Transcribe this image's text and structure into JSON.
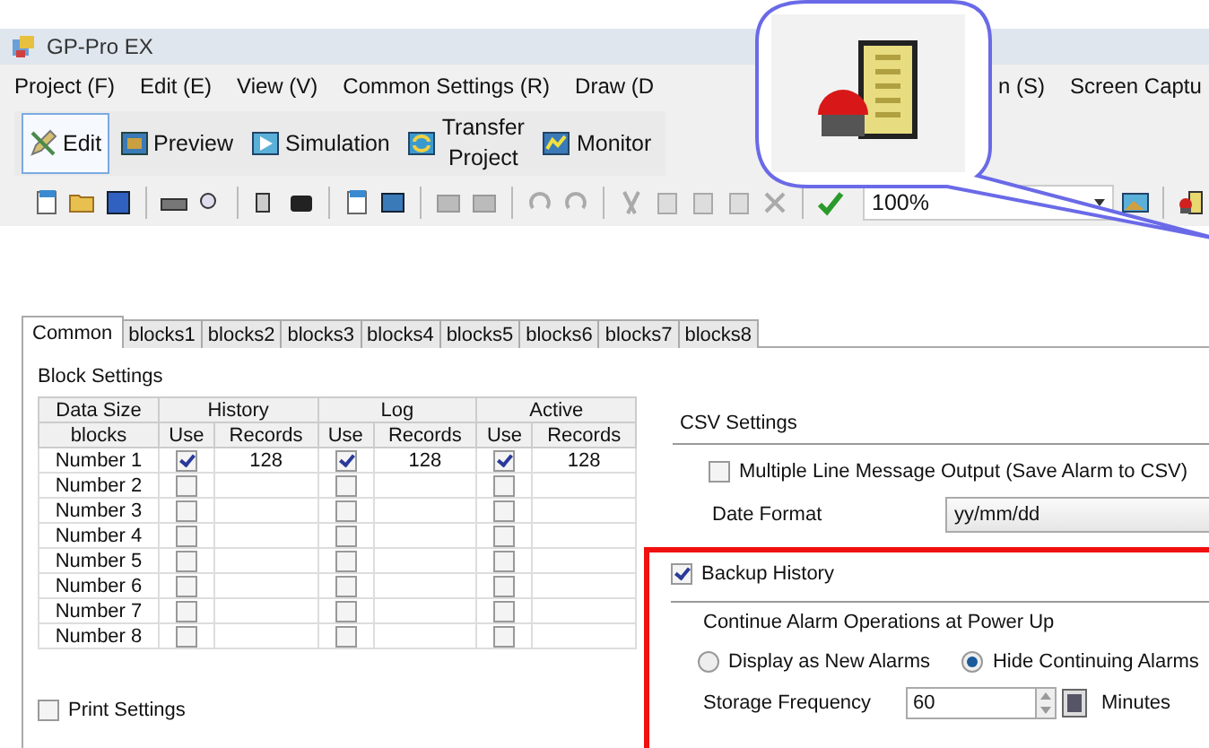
{
  "window": {
    "title": "GP-Pro EX"
  },
  "menu": {
    "items_before_callout": [
      "Project (F)",
      "Edit (E)",
      "View (V)",
      "Common Settings (R)",
      "Draw (D"
    ],
    "items_after_callout": [
      "n (S)",
      "Screen Captu"
    ]
  },
  "main_toolbar": [
    {
      "label": "Edit",
      "selected": true
    },
    {
      "label": "Preview",
      "selected": false
    },
    {
      "label": "Simulation",
      "selected": false
    },
    {
      "label": "Transfer\nProject",
      "selected": false
    },
    {
      "label": "Monitor",
      "selected": false
    }
  ],
  "zoom_combo": {
    "value": "100%"
  },
  "tabs": [
    {
      "label": "Common",
      "selected": true
    },
    {
      "label": "blocks1",
      "selected": false
    },
    {
      "label": "blocks2",
      "selected": false
    },
    {
      "label": "blocks3",
      "selected": false
    },
    {
      "label": "blocks4",
      "selected": false
    },
    {
      "label": "blocks5",
      "selected": false
    },
    {
      "label": "blocks6",
      "selected": false
    },
    {
      "label": "blocks7",
      "selected": false
    },
    {
      "label": "blocks8",
      "selected": false
    }
  ],
  "block_settings": {
    "title": "Block Settings",
    "header_top": [
      "Data Size",
      "History",
      "Log",
      "Active"
    ],
    "header_sub": [
      "blocks",
      "Use",
      "Records",
      "Use",
      "Records",
      "Use",
      "Records"
    ],
    "rows": [
      {
        "name": "Number 1",
        "history": {
          "checked": true,
          "records": "128"
        },
        "log": {
          "checked": true,
          "records": "128"
        },
        "active": {
          "checked": true,
          "records": "128"
        }
      },
      {
        "name": "Number 2",
        "history": {
          "checked": false
        },
        "log": {
          "checked": false
        },
        "active": {
          "checked": false
        }
      },
      {
        "name": "Number 3",
        "history": {
          "checked": false
        },
        "log": {
          "checked": false
        },
        "active": {
          "checked": false
        }
      },
      {
        "name": "Number 4",
        "history": {
          "checked": false
        },
        "log": {
          "checked": false
        },
        "active": {
          "checked": false
        }
      },
      {
        "name": "Number 5",
        "history": {
          "checked": false
        },
        "log": {
          "checked": false
        },
        "active": {
          "checked": false
        }
      },
      {
        "name": "Number 6",
        "history": {
          "checked": false
        },
        "log": {
          "checked": false
        },
        "active": {
          "checked": false
        }
      },
      {
        "name": "Number 7",
        "history": {
          "checked": false
        },
        "log": {
          "checked": false
        },
        "active": {
          "checked": false
        }
      },
      {
        "name": "Number 8",
        "history": {
          "checked": false
        },
        "log": {
          "checked": false
        },
        "active": {
          "checked": false
        }
      }
    ]
  },
  "print_settings": {
    "label": "Print Settings",
    "checked": false
  },
  "csv_settings": {
    "title": "CSV Settings",
    "multiline": {
      "label": "Multiple Line Message Output (Save Alarm to CSV)",
      "checked": false
    },
    "date_format": {
      "label": "Date Format",
      "value": "yy/mm/dd"
    }
  },
  "backup": {
    "label": "Backup History",
    "checked": true,
    "continue_title": "Continue Alarm Operations at Power Up",
    "options": [
      {
        "label": "Display as New Alarms",
        "selected": false
      },
      {
        "label": "Hide Continuing Alarms",
        "selected": true
      }
    ],
    "storage_frequency": {
      "label": "Storage Frequency",
      "value": "60",
      "unit": "Minutes"
    }
  }
}
